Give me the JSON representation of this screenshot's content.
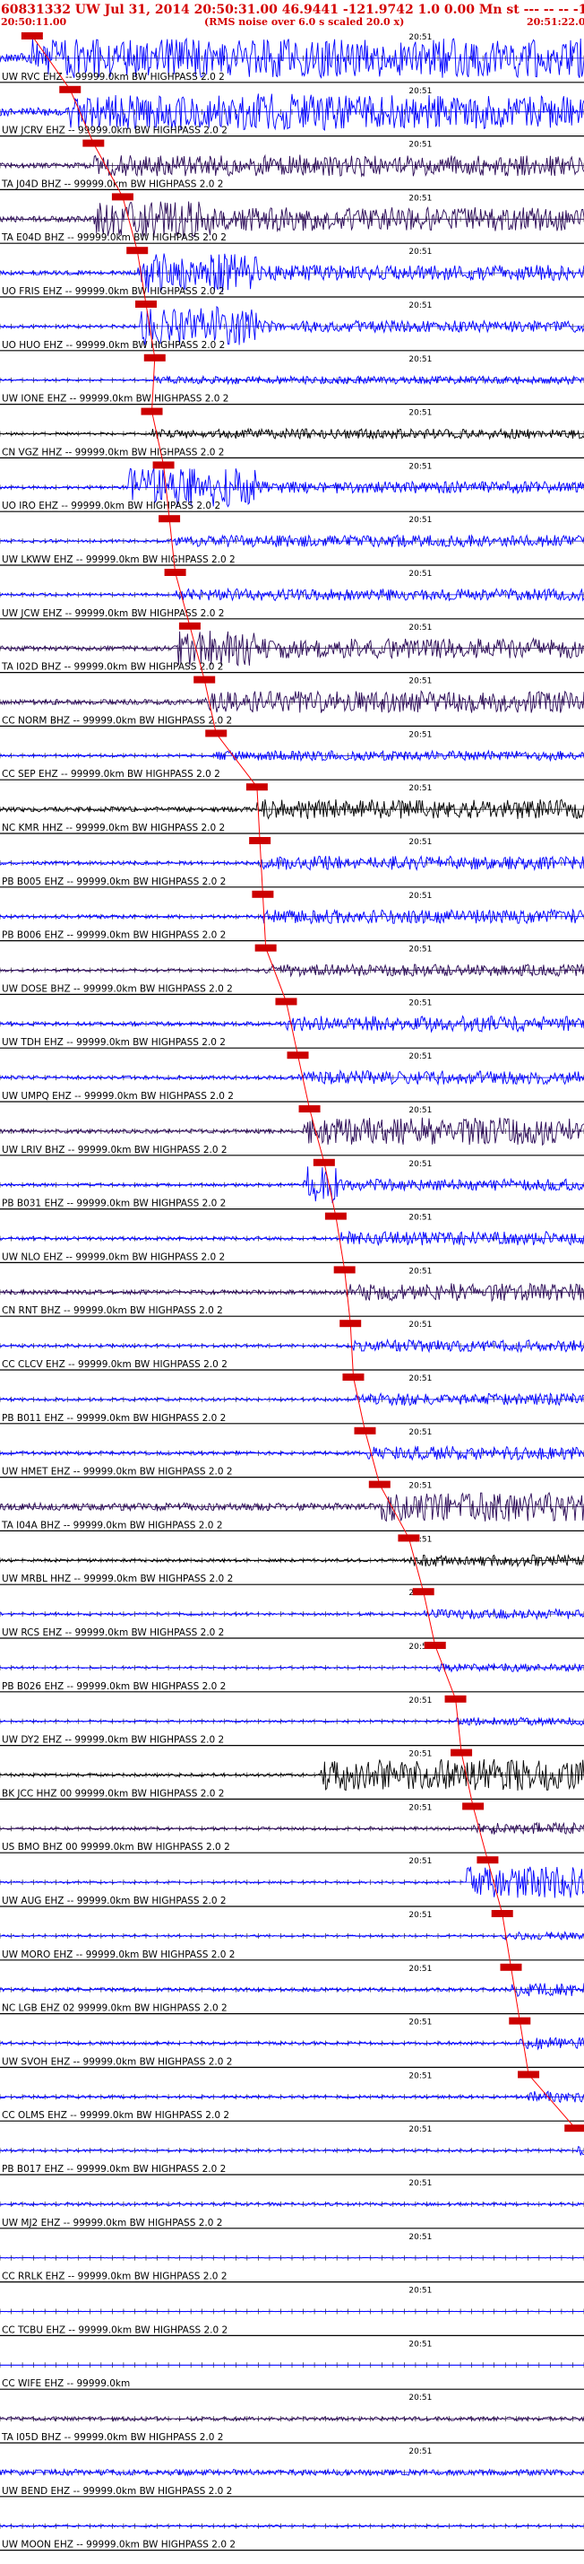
{
  "header": {
    "title": "60831332 UW Jul 31, 2014 20:50:31.00   46.9441 -121.9742  1.0 0.00 Mn st --- -- -- -1",
    "start_time": "20:50:11.00",
    "rms_note": "(RMS noise over 6.0 s scaled 20.0 x)",
    "end_time": "20:51:22.00"
  },
  "chart_data": {
    "type": "seismogram",
    "traces": [
      {
        "label": "UW RVC  EHZ -- 99999.0km BW  HIGHPASS  2.0  2",
        "time_mark": "20:51",
        "color": "#0000ff",
        "pick": 0.055,
        "amp": 1.0,
        "bursts": [
          [
            0.45,
            1.0,
            1.0
          ],
          [
            0.2,
            0.45,
            0.5
          ]
        ]
      },
      {
        "label": "UW JCRV EHZ -- 99999.0km BW  HIGHPASS  2.0  2",
        "time_mark": "20:51",
        "color": "#0000ff",
        "pick": 0.12,
        "amp": 0.85,
        "bursts": [
          [
            0.15,
            0.33,
            0.9
          ],
          [
            0.41,
            0.56,
            0.95
          ]
        ]
      },
      {
        "label": "TA J04D BHZ -- 99999.0km BW  HIGHPASS  2.0  2",
        "time_mark": "20:51",
        "color": "#2b0a57",
        "pick": 0.16,
        "amp": 0.55,
        "bursts": []
      },
      {
        "label": "TA E04D BHZ -- 99999.0km BW  HIGHPASS  2.0  2",
        "time_mark": "20:51",
        "color": "#2b0a57",
        "pick": 0.21,
        "amp": 0.6,
        "bursts": [
          [
            0.16,
            0.36,
            0.9
          ]
        ]
      },
      {
        "label": "UO FRIS EHZ -- 99999.0km BW  HIGHPASS  2.0  2",
        "time_mark": "20:51",
        "color": "#0000ff",
        "pick": 0.235,
        "amp": 0.4,
        "bursts": [
          [
            0.24,
            0.44,
            1.0
          ]
        ]
      },
      {
        "label": "UO HUO  EHZ -- 99999.0km BW  HIGHPASS  2.0  2",
        "time_mark": "20:51",
        "color": "#0000ff",
        "pick": 0.25,
        "amp": 0.3,
        "bursts": [
          [
            0.24,
            0.44,
            1.0
          ]
        ]
      },
      {
        "label": "UW IONE EHZ -- 99999.0km BW  HIGHPASS  2.0  2",
        "time_mark": "20:51",
        "color": "#0000ff",
        "pick": 0.265,
        "amp": 0.2,
        "bursts": []
      },
      {
        "label": "CN VGZ  HHZ -- 99999.0km BW  HIGHPASS  2.0  2",
        "time_mark": "20:51",
        "color": "#000000",
        "pick": 0.26,
        "amp": 0.25,
        "bursts": []
      },
      {
        "label": "UO IRO  EHZ -- 99999.0km BW  HIGHPASS  2.0  2",
        "time_mark": "20:51",
        "color": "#0000ff",
        "pick": 0.28,
        "amp": 0.3,
        "bursts": [
          [
            0.22,
            0.44,
            1.0
          ]
        ]
      },
      {
        "label": "UW LKWW EHZ -- 99999.0km BW  HIGHPASS  2.0  2",
        "time_mark": "20:51",
        "color": "#0000ff",
        "pick": 0.29,
        "amp": 0.3,
        "bursts": []
      },
      {
        "label": "UW JCW  EHZ -- 99999.0km BW  HIGHPASS  2.0  2",
        "time_mark": "20:51",
        "color": "#0000ff",
        "pick": 0.3,
        "amp": 0.3,
        "bursts": []
      },
      {
        "label": "TA I02D BHZ -- 99999.0km BW  HIGHPASS  2.0  2",
        "time_mark": "20:51",
        "color": "#2b0a57",
        "pick": 0.325,
        "amp": 0.5,
        "bursts": [
          [
            0.3,
            0.44,
            0.9
          ]
        ]
      },
      {
        "label": "CC NORM BHZ -- 99999.0km BW  HIGHPASS  2.0  2",
        "time_mark": "20:51",
        "color": "#2b0a57",
        "pick": 0.35,
        "amp": 0.55,
        "bursts": []
      },
      {
        "label": "CC SEP  EHZ -- 99999.0km BW  HIGHPASS  2.0  2",
        "time_mark": "20:51",
        "color": "#0000ff",
        "pick": 0.37,
        "amp": 0.25,
        "bursts": []
      },
      {
        "label": "NC KMR  HHZ -- 99999.0km BW  HIGHPASS  2.0  2",
        "time_mark": "20:51",
        "color": "#000000",
        "pick": 0.44,
        "amp": 0.5,
        "bursts": []
      },
      {
        "label": "PB B005 EHZ -- 99999.0km BW  HIGHPASS  2.0  2",
        "time_mark": "20:51",
        "color": "#0000ff",
        "pick": 0.445,
        "amp": 0.35,
        "bursts": []
      },
      {
        "label": "PB B006 EHZ -- 99999.0km BW  HIGHPASS  2.0  2",
        "time_mark": "20:51",
        "color": "#0000ff",
        "pick": 0.45,
        "amp": 0.35,
        "bursts": []
      },
      {
        "label": "UW DOSE BHZ -- 99999.0km BW  HIGHPASS  2.0  2",
        "time_mark": "20:51",
        "color": "#2b0a57",
        "pick": 0.455,
        "amp": 0.3,
        "bursts": []
      },
      {
        "label": "UW TDH  EHZ -- 99999.0km BW  HIGHPASS  2.0  2",
        "time_mark": "20:51",
        "color": "#0000ff",
        "pick": 0.49,
        "amp": 0.4,
        "bursts": []
      },
      {
        "label": "UW UMPQ EHZ -- 99999.0km BW  HIGHPASS  2.0  2",
        "time_mark": "20:51",
        "color": "#0000ff",
        "pick": 0.51,
        "amp": 0.35,
        "bursts": []
      },
      {
        "label": "UW LRIV BHZ -- 99999.0km BW  HIGHPASS  2.0  2",
        "time_mark": "20:51",
        "color": "#2b0a57",
        "pick": 0.53,
        "amp": 0.4,
        "bursts": [
          [
            0.52,
            0.98,
            0.7
          ]
        ]
      },
      {
        "label": "PB B031 EHZ -- 99999.0km BW  HIGHPASS  2.0  2",
        "time_mark": "20:51",
        "color": "#0000ff",
        "pick": 0.555,
        "amp": 0.3,
        "bursts": [
          [
            0.52,
            0.58,
            1.0
          ]
        ]
      },
      {
        "label": "UW NLO  EHZ -- 99999.0km BW  HIGHPASS  2.0  2",
        "time_mark": "20:51",
        "color": "#0000ff",
        "pick": 0.575,
        "amp": 0.35,
        "bursts": []
      },
      {
        "label": "CN RNT  BHZ -- 99999.0km BW  HIGHPASS  2.0  2",
        "time_mark": "20:51",
        "color": "#2b0a57",
        "pick": 0.59,
        "amp": 0.45,
        "bursts": []
      },
      {
        "label": "CC CLCV EHZ -- 99999.0km BW  HIGHPASS  2.0  2",
        "time_mark": "20:51",
        "color": "#0000ff",
        "pick": 0.6,
        "amp": 0.3,
        "bursts": []
      },
      {
        "label": "PB B011 EHZ -- 99999.0km BW  HIGHPASS  2.0  2",
        "time_mark": "20:51",
        "color": "#0000ff",
        "pick": 0.605,
        "amp": 0.3,
        "bursts": []
      },
      {
        "label": "UW HMET EHZ -- 99999.0km BW  HIGHPASS  2.0  2",
        "time_mark": "20:51",
        "color": "#0000ff",
        "pick": 0.625,
        "amp": 0.35,
        "bursts": []
      },
      {
        "label": "TA I04A BHZ -- 99999.0km BW  HIGHPASS  2.0  2",
        "time_mark": "20:51",
        "color": "#2b0a57",
        "pick": 0.65,
        "amp": 0.75,
        "bursts": []
      },
      {
        "label": "UW MRBL HHZ -- 99999.0km BW  HIGHPASS  2.0  2",
        "time_mark": "20:51",
        "color": "#000000",
        "pick": 0.7,
        "amp": 0.3,
        "bursts": []
      },
      {
        "label": "UW RCS  EHZ -- 99999.0km BW  HIGHPASS  2.0  2",
        "time_mark": "20:51",
        "color": "#0000ff",
        "pick": 0.725,
        "amp": 0.25,
        "bursts": []
      },
      {
        "label": "PB B026 EHZ -- 99999.0km BW  HIGHPASS  2.0  2",
        "time_mark": "20:51",
        "color": "#0000ff",
        "pick": 0.745,
        "amp": 0.2,
        "bursts": []
      },
      {
        "label": "UW DY2  EHZ -- 99999.0km BW  HIGHPASS  2.0  2",
        "time_mark": "20:51",
        "color": "#0000ff",
        "pick": 0.78,
        "amp": 0.2,
        "bursts": []
      },
      {
        "label": "BK JCC  HHZ 00 99999.0km BW  HIGHPASS  2.0  2",
        "time_mark": "20:51",
        "color": "#000000",
        "pick": 0.79,
        "amp": 0.3,
        "bursts": [
          [
            0.55,
            1.0,
            0.8
          ]
        ]
      },
      {
        "label": "US BMO  BHZ 00 99999.0km BW  HIGHPASS  2.0  2",
        "time_mark": "20:51",
        "color": "#2b0a57",
        "pick": 0.81,
        "amp": 0.3,
        "bursts": []
      },
      {
        "label": "UW AUG  EHZ -- 99999.0km BW  HIGHPASS  2.0  2",
        "time_mark": "20:51",
        "color": "#0000ff",
        "pick": 0.835,
        "amp": 0.2,
        "bursts": [
          [
            0.8,
            1.0,
            0.8
          ]
        ]
      },
      {
        "label": "UW MORO EHZ -- 99999.0km BW  HIGHPASS  2.0  2",
        "time_mark": "20:51",
        "color": "#0000ff",
        "pick": 0.86,
        "amp": 0.2,
        "bursts": []
      },
      {
        "label": "NC LGB  EHZ 02 99999.0km BW  HIGHPASS  2.0  2",
        "time_mark": "20:51",
        "color": "#0000ff",
        "pick": 0.875,
        "amp": 0.35,
        "bursts": []
      },
      {
        "label": "UW SVOH EHZ -- 99999.0km BW  HIGHPASS  2.0  2",
        "time_mark": "20:51",
        "color": "#0000ff",
        "pick": 0.89,
        "amp": 0.3,
        "bursts": []
      },
      {
        "label": "CC OLMS EHZ -- 99999.0km BW  HIGHPASS  2.0  2",
        "time_mark": "20:51",
        "color": "#0000ff",
        "pick": 0.905,
        "amp": 0.3,
        "bursts": []
      },
      {
        "label": "PB B017 EHZ -- 99999.0km BW  HIGHPASS  2.0  2",
        "time_mark": "20:51",
        "color": "#0000ff",
        "pick": 0.985,
        "amp": 0.25,
        "bursts": []
      },
      {
        "label": "UW MJ2  EHZ -- 99999.0km BW  HIGHPASS  2.0  2",
        "time_mark": "20:51",
        "color": "#0000ff",
        "pick": null,
        "amp": 0.15,
        "bursts": []
      },
      {
        "label": "CC RRLK EHZ -- 99999.0km BW  HIGHPASS  2.0  2",
        "time_mark": "20:51",
        "color": "#0000ff",
        "pick": null,
        "amp": 0.03,
        "bursts": []
      },
      {
        "label": "CC TCBU EHZ -- 99999.0km BW  HIGHPASS  2.0  2",
        "time_mark": "20:51",
        "color": "#0000ff",
        "pick": null,
        "amp": 0.03,
        "bursts": []
      },
      {
        "label": "CC WIFE EHZ -- 99999.0km",
        "time_mark": "20:51",
        "color": "#0000ff",
        "pick": null,
        "amp": 0.0,
        "bursts": []
      },
      {
        "label": "TA I05D BHZ -- 99999.0km BW  HIGHPASS  2.0  2",
        "time_mark": "20:51",
        "color": "#2b0a57",
        "pick": null,
        "amp": 0.2,
        "bursts": []
      },
      {
        "label": "UW BEND EHZ -- 99999.0km BW  HIGHPASS  2.0  2",
        "time_mark": "20:51",
        "color": "#0000ff",
        "pick": null,
        "amp": 0.3,
        "bursts": []
      },
      {
        "label": "UW MOON EHZ -- 99999.0km BW  HIGHPASS  2.0  2",
        "time_mark": "",
        "color": "#0000ff",
        "pick": null,
        "amp": 0.1,
        "bursts": []
      }
    ],
    "time_mark_position": 0.7,
    "pick_color": "#ff0000",
    "pick_box_color": "#cc0000",
    "label_color": "#000000",
    "header_color": "#d40000"
  }
}
